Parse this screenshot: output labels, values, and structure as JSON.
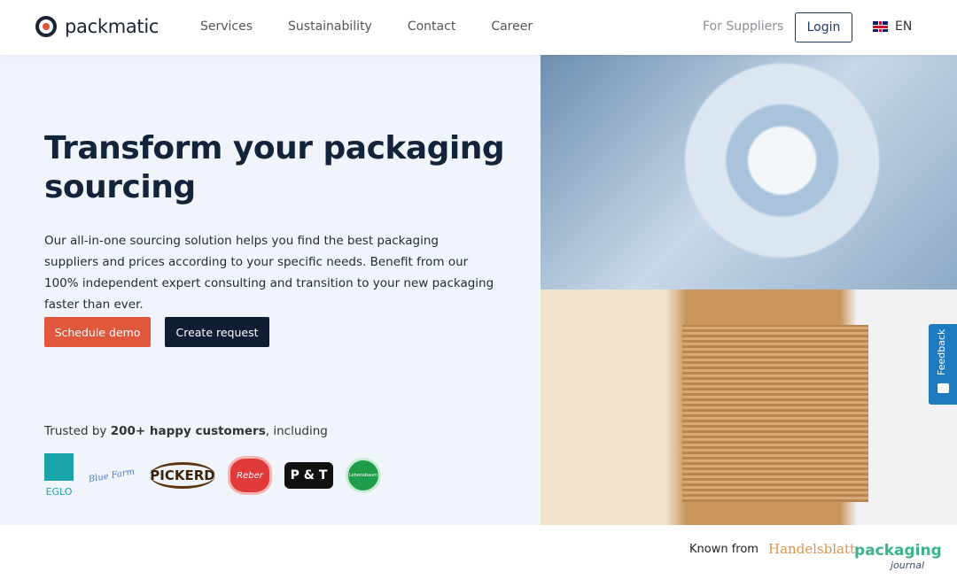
{
  "nav": {
    "brand": "packmatic",
    "menu": [
      "Services",
      "Sustainability",
      "Contact",
      "Career"
    ],
    "for_suppliers": "For Suppliers",
    "login": "Login",
    "language": "EN"
  },
  "hero": {
    "title": "Transform your packaging sourcing",
    "description": "Our all-in-one sourcing solution helps you find the best packaging suppliers and prices according to your specific needs. Benefit from our 100% independent expert consulting and transition to your new packaging faster than ever.",
    "schedule_demo": "Schedule demo",
    "create_request": "Create request",
    "trusted_prefix": "Trusted by ",
    "trusted_bold": "200+ happy customers",
    "trusted_suffix": ", including",
    "customer_logos": [
      "EGLO",
      "Blue Farm",
      "PICKERD",
      "Reber",
      "P & T",
      "Lebensbaum"
    ]
  },
  "feedback": "Feedback",
  "known_from": {
    "label": "Known from",
    "logos": [
      "Handelsblatt",
      "packaging",
      "journal"
    ]
  },
  "colors": {
    "accent": "#e0573c",
    "dark": "#0f1d33",
    "feedback": "#1e7bbf"
  }
}
